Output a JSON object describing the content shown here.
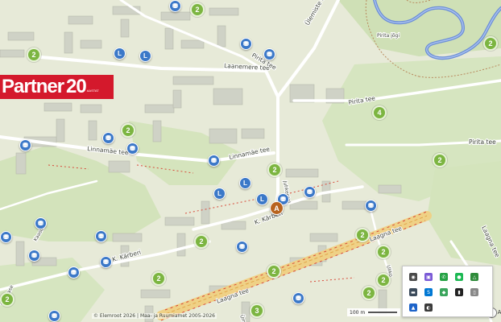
{
  "map": {
    "street_labels": {
      "laanemere_tee": "Laanemere tee",
      "linnamae_tee_west": "Linnamäe tee",
      "linnamae_tee_east": "Linnamäe tee",
      "pirita_tee": "Pirita tee",
      "ulemiste_tee": "Ülemiste tee",
      "pirita_jogi": "Pirita jõgi",
      "pirita_tee_east": "Pirita tee",
      "pirita_tee_far_east": "Pirita tee",
      "k_karberi_road": "K. Kärberi",
      "k_karberi_west": "K. Kärberi",
      "laagna_tee_center": "Laagna tee",
      "laagna_tee_east": "Laagna tee",
      "laagna_tee_right": "Laagna tee",
      "kaasik": "Kaasik",
      "vikerlase": "Vikerlase",
      "ulemiste_south": "Ümera",
      "uliko": "Uliko",
      "juhkentali": "Juhkental"
    },
    "clusters": [
      "2",
      "2",
      "2",
      "2",
      "2",
      "4",
      "2",
      "2",
      "2",
      "2",
      "2",
      "2",
      "2",
      "2",
      "3",
      "2"
    ],
    "poi_letters": [
      "L",
      "L",
      "L",
      "L",
      "L"
    ],
    "active_pin": "A"
  },
  "banner": {
    "brand": "Partner",
    "number": "20",
    "suffix": "AASTAT"
  },
  "attribution": "© Elemroot 2026 | Maa- ja Ruumiamet 2005-2026",
  "scale": {
    "label": "100 m"
  },
  "controls": {
    "help": "?",
    "account": "A"
  },
  "tray_icons": [
    "chrome-icon",
    "purple-app-icon",
    "whatsapp-icon",
    "spotify-icon",
    "green-app-icon",
    "folder-icon",
    "skype-icon",
    "green-chat-icon",
    "terminal-icon",
    "battery-icon",
    "blue-app-icon",
    "network-icon"
  ]
}
